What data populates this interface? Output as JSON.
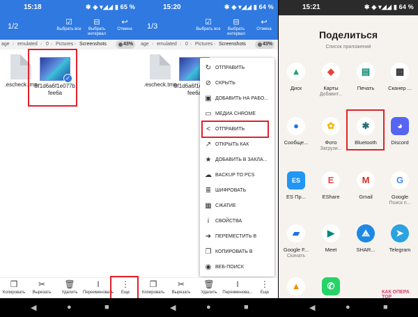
{
  "panel1": {
    "status": {
      "time": "15:18",
      "icons": "✱ ◈ ▾◢◢ ▮ 65 %"
    },
    "toolbar": {
      "count": "1/2",
      "select_all": "Выбрать все",
      "select_range": "Выбрать интервал",
      "cancel": "Отмена"
    },
    "crumb": {
      "parts": [
        "age",
        "emulated",
        "0",
        "Pictures",
        "Screenshots"
      ],
      "storage_pct": "43%"
    },
    "files": [
      {
        "name": ".escheck.tmp"
      },
      {
        "name": "9f1d6a6f1e077bfee6a",
        "selected": true
      }
    ],
    "bottom": [
      "Копировать",
      "Вырезать",
      "Удалить",
      "Переименовать",
      "Еще"
    ]
  },
  "panel2": {
    "status": {
      "time": "15:20",
      "icons": "✱ ◈ ▾◢◢ ▮ 64 %"
    },
    "toolbar": {
      "count": "1/3",
      "select_all": "Выбрать все",
      "select_range": "Выбрать интервал",
      "cancel": "Отмена"
    },
    "crumb": {
      "parts": [
        "age",
        "emulated",
        "0",
        "Pictures",
        "Screenshots"
      ],
      "storage_pct": "43%"
    },
    "files": [
      {
        "name": ".escheck.tmp"
      },
      {
        "name": "9f1d6a6f1e077bfee6a"
      }
    ],
    "menu": [
      {
        "icon": "share-circle-icon",
        "glyph": "↻",
        "label": "ОТПРАВИТЬ"
      },
      {
        "icon": "hide-icon",
        "glyph": "⊘",
        "label": "СКРЫТЬ"
      },
      {
        "icon": "add-desktop-icon",
        "glyph": "▣",
        "label": "ДОБАВИТЬ НА РАБО..."
      },
      {
        "icon": "cast-icon",
        "glyph": "▭",
        "label": "МЕДИА CHROME"
      },
      {
        "icon": "share-icon",
        "glyph": "<",
        "label": "ОТПРАВИТЬ",
        "highlight": true
      },
      {
        "icon": "open-as-icon",
        "glyph": "↗",
        "label": "ОТКРЫТЬ КАК"
      },
      {
        "icon": "bookmark-star-icon",
        "glyph": "★",
        "label": "ДОБАВИТЬ В ЗАКЛА..."
      },
      {
        "icon": "cloud-backup-icon",
        "glyph": "☁",
        "label": "BACKUP TO PCS"
      },
      {
        "icon": "encrypt-icon",
        "glyph": "≣",
        "label": "ШИФРОВАТЬ"
      },
      {
        "icon": "compress-icon",
        "glyph": "▦",
        "label": "СЖАТИЕ"
      },
      {
        "icon": "info-icon",
        "glyph": "i",
        "label": "СВОЙСТВА"
      },
      {
        "icon": "move-icon",
        "glyph": "➜",
        "label": "ПЕРЕМЕСТИТЬ В"
      },
      {
        "icon": "copy-icon",
        "glyph": "❐",
        "label": "КОПИРОВАТЬ В"
      },
      {
        "icon": "web-search-icon",
        "glyph": "◉",
        "label": "ВЕБ-ПОИСК"
      }
    ],
    "bottom": [
      "Копировать",
      "Вырезать",
      "Удалить",
      "Переименова...",
      "Еще"
    ]
  },
  "panel3": {
    "status": {
      "time": "15:21",
      "icons": "✱ ◈ ▾◢◢ ▮ 64 %"
    },
    "title": "Поделиться",
    "subtitle": "Список приложений",
    "apps": [
      {
        "icon": "google-drive-icon",
        "glyph": "▲",
        "color": "#1fa463",
        "name": "Диск",
        "sub": ""
      },
      {
        "icon": "google-maps-icon",
        "glyph": "◆",
        "color": "#ea4335",
        "name": "Карты",
        "sub": "Добавит..."
      },
      {
        "icon": "print-icon",
        "glyph": "▤",
        "color": "#0b8a6f",
        "name": "Печать",
        "sub": ""
      },
      {
        "icon": "qr-scanner-icon",
        "glyph": "▩",
        "color": "#333333",
        "name": "Сканер ...",
        "sub": ""
      },
      {
        "icon": "messages-icon",
        "glyph": "●",
        "color": "#1a73e8",
        "name": "Сообще...",
        "sub": ""
      },
      {
        "icon": "google-photos-icon",
        "glyph": "✿",
        "color": "#f4b400",
        "name": "Фото",
        "sub": "Загрузи..."
      },
      {
        "icon": "bluetooth-icon",
        "glyph": "✱",
        "color": "#2a6e78",
        "name": "Bluetooth",
        "sub": ""
      },
      {
        "icon": "discord-icon",
        "glyph": "◕",
        "color": "#ffffff",
        "name": "Discord",
        "sub": ""
      },
      {
        "icon": "es-explorer-icon",
        "glyph": "ES",
        "color": "#ffffff",
        "name": "ES Пр...",
        "sub": ""
      },
      {
        "icon": "eshare-icon",
        "glyph": "E",
        "color": "#e8434b",
        "name": "EShare",
        "sub": ""
      },
      {
        "icon": "gmail-icon",
        "glyph": "M",
        "color": "#d93025",
        "name": "Gmail",
        "sub": ""
      },
      {
        "icon": "google-icon",
        "glyph": "G",
        "color": "#4285f4",
        "name": "Google",
        "sub": "Поиск п..."
      },
      {
        "icon": "google-files-icon",
        "glyph": "▰",
        "color": "#1a73e8",
        "name": "Google F...",
        "sub": "Скачать"
      },
      {
        "icon": "meet-icon",
        "glyph": "▶",
        "color": "#00897b",
        "name": "Meet",
        "sub": ""
      },
      {
        "icon": "shareit-icon",
        "glyph": "⟁",
        "color": "#ffffff",
        "name": "SHAR...",
        "sub": ""
      },
      {
        "icon": "telegram-icon",
        "glyph": "➤",
        "color": "#ffffff",
        "name": "Telegram",
        "sub": ""
      },
      {
        "icon": "vlc-icon",
        "glyph": "▲",
        "color": "#ff8800",
        "name": "VLC",
        "sub": ""
      },
      {
        "icon": "whatsapp-icon",
        "glyph": "✆",
        "color": "#ffffff",
        "name": "WhatsApp",
        "sub": ""
      }
    ],
    "watermark": "КАК ОПЕРА ТОР"
  },
  "colors": {
    "accent": "#2f79e0",
    "highlight": "#e0202a"
  }
}
